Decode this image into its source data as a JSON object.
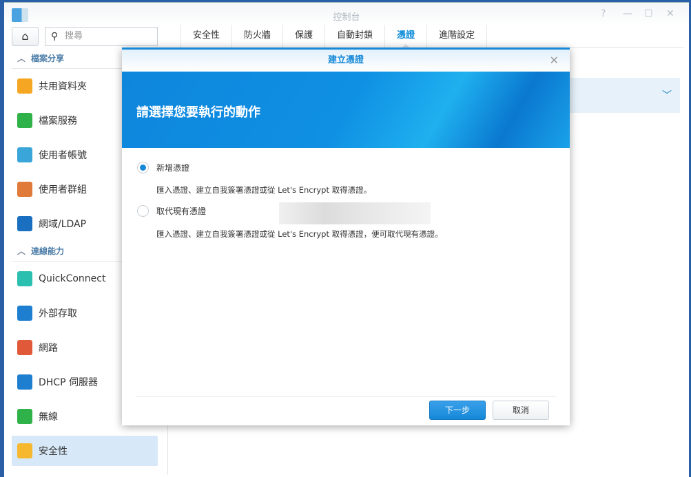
{
  "window": {
    "title": "控制台",
    "help": "?",
    "minimize": "—",
    "maximize": "☐",
    "close": "✕"
  },
  "search": {
    "placeholder": "搜尋"
  },
  "tabs": [
    "安全性",
    "防火牆",
    "保護",
    "自動封鎖",
    "憑證",
    "進階設定"
  ],
  "active_tab": "憑證",
  "sidebar": {
    "sections": [
      {
        "label": "檔案分享",
        "items": [
          {
            "label": "共用資料夾",
            "color": "#f5a623"
          },
          {
            "label": "檔案服務",
            "color": "#2fb24a"
          },
          {
            "label": "使用者帳號",
            "color": "#3aa5d8"
          },
          {
            "label": "使用者群組",
            "color": "#e07a3a"
          },
          {
            "label": "網域/LDAP",
            "color": "#1a6fc0"
          }
        ]
      },
      {
        "label": "連線能力",
        "items": [
          {
            "label": "QuickConnect",
            "color": "#2bbfb0"
          },
          {
            "label": "外部存取",
            "color": "#1e7fd0"
          },
          {
            "label": "網路",
            "color": "#e05a3a"
          },
          {
            "label": "DHCP 伺服器",
            "color": "#1e7fd0"
          },
          {
            "label": "無線",
            "color": "#2fb24a"
          },
          {
            "label": "安全性",
            "color": "#f5b82e"
          }
        ]
      }
    ],
    "selected": "安全性"
  },
  "dialog": {
    "title": "建立憑證",
    "close": "✕",
    "banner": "請選擇您要執行的動作",
    "options": [
      {
        "label": "新增憑證",
        "desc": "匯入憑證、建立自我簽署憑證或從 Let's Encrypt 取得憑證。",
        "selected": true
      },
      {
        "label": "取代現有憑證",
        "desc": "匯入憑證、建立自我簽署憑證或從 Let's Encrypt 取得憑證，便可取代現有憑證。",
        "selected": false
      }
    ],
    "next": "下一步",
    "cancel": "取消"
  },
  "colors": {
    "accent": "#1588d8",
    "selected_bg": "#d7e9f8"
  }
}
